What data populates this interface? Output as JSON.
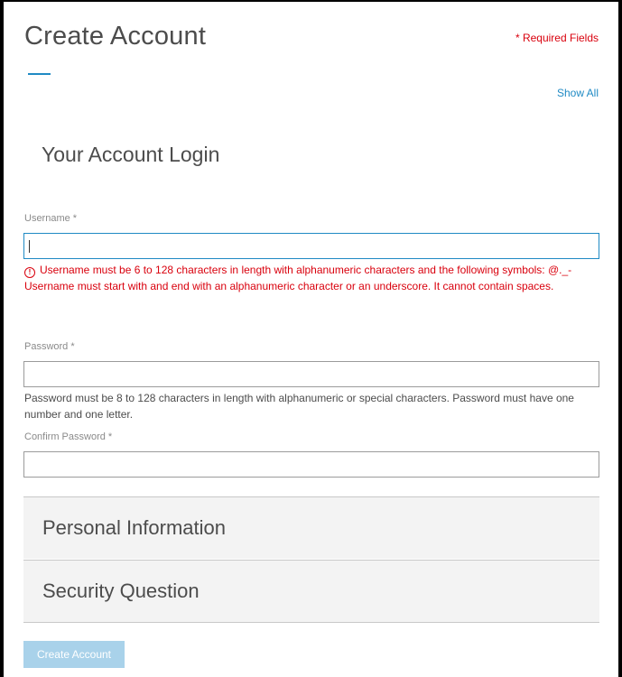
{
  "header": {
    "title": "Create Account",
    "required_note": "* Required Fields",
    "show_all": "Show All"
  },
  "login_section": {
    "title": "Your Account Login",
    "username": {
      "label": "Username *",
      "value": "",
      "focused": true,
      "errors": [
        "Username must be 6 to 128 characters in length with alphanumeric characters and the following symbols: @._-",
        "Username must start with and end with an alphanumeric character or an underscore. It cannot contain spaces."
      ]
    },
    "password": {
      "label": "Password *",
      "value": "",
      "hint": "Password must be 8 to 128 characters in length with alphanumeric or special characters. Password must have one number and one letter."
    },
    "confirm_password": {
      "label": "Confirm Password *",
      "value": ""
    }
  },
  "collapsed_sections": [
    {
      "label": "Personal Information"
    },
    {
      "label": "Security Question"
    }
  ],
  "actions": {
    "create_account": "Create Account"
  },
  "colors": {
    "accent": "#1f8ac4",
    "error": "#d9000d",
    "button_disabled": "#a9d2ea",
    "section_bg": "#f3f3f3"
  },
  "icons": {
    "error": "alert-circle-icon"
  }
}
